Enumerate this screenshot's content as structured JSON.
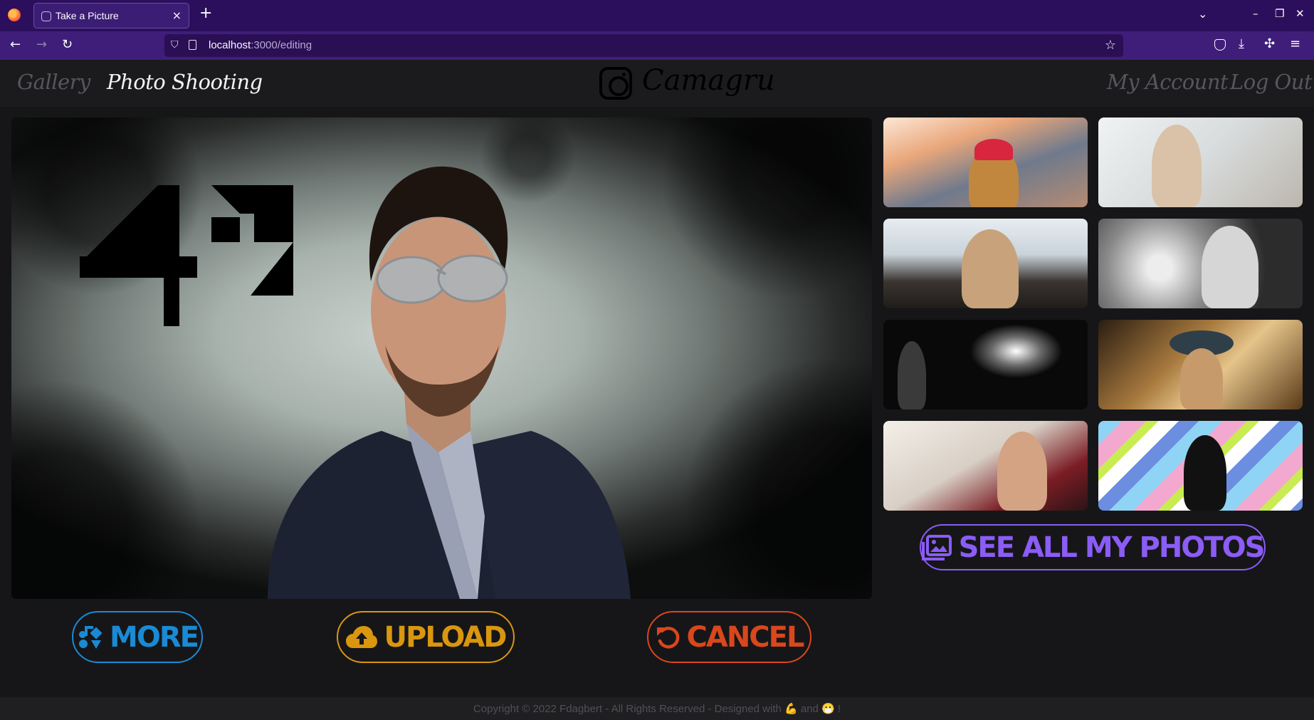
{
  "browser": {
    "tab_title": "Take a Picture",
    "tab_close": "×",
    "new_tab": "+",
    "url_host": "localhost",
    "url_path": ":3000/editing"
  },
  "header": {
    "nav_left": [
      "Gallery",
      "Photo Shooting"
    ],
    "brand": "Camagru",
    "nav_right": [
      "My Account",
      "Log Out"
    ]
  },
  "preview": {
    "overlay_logo": "42"
  },
  "actions": {
    "more": "MORE",
    "upload": "UPLOAD",
    "cancel": "CANCEL",
    "see_all": "SEE ALL MY PHOTOS"
  },
  "icons": {
    "more": "music-shapes-icon",
    "upload": "cloud-upload-icon",
    "cancel": "undo-icon",
    "see_all": "images-icon"
  },
  "colors": {
    "more": "#1a8ad4",
    "upload": "#d9960f",
    "cancel": "#d9471c",
    "see_all": "#8b5cf6"
  },
  "footer": {
    "text": "Copyright © 2022 Fdagbert - All Rights Reserved - Designed with 💪 and 😷 !"
  }
}
